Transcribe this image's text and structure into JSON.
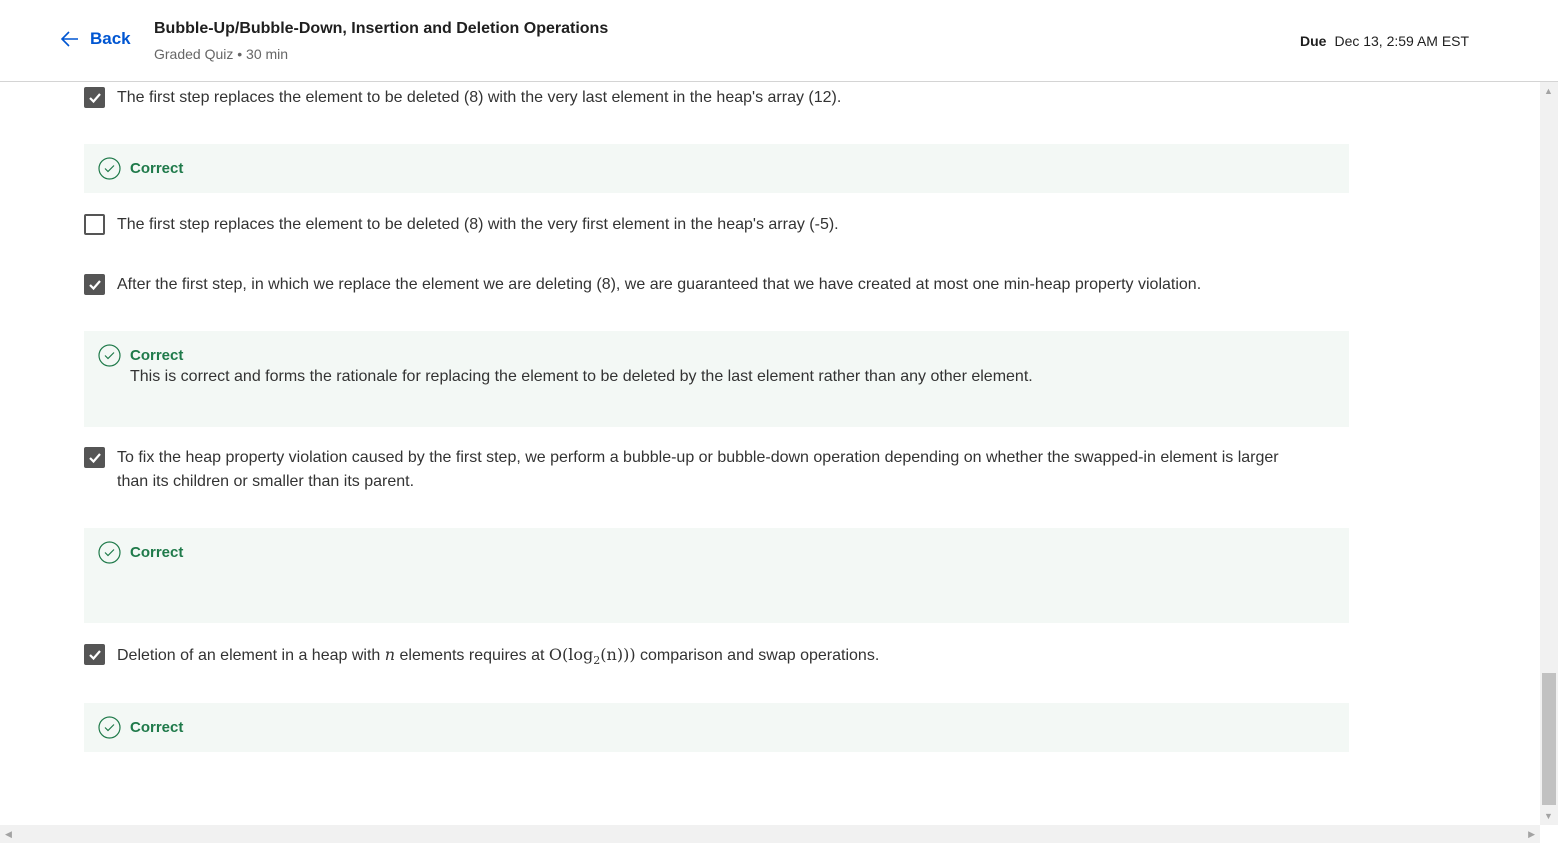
{
  "header": {
    "back_label": "Back",
    "title": "Bubble-Up/Bubble-Down, Insertion and Deletion Operations",
    "subtitle": "Graded Quiz • 30 min",
    "due_label": "Due",
    "due_value": "Dec 13, 2:59 AM EST"
  },
  "options": [
    {
      "text": "The first step replaces the element to be deleted (8) with the very last element in the heap's array (12).",
      "checked": true,
      "feedback": "Correct"
    },
    {
      "text": "The first step replaces the element to be deleted (8) with the very first element in the heap's array (-5).",
      "checked": false
    },
    {
      "text": "After the first step, in which we replace the element we are deleting (8), we are guaranteed that we have created at most one min-heap property violation.",
      "checked": true,
      "feedback": "Correct",
      "explanation": "This is correct and forms the rationale for replacing the element to be deleted by the last element rather than any other element."
    },
    {
      "text": "To fix the heap property violation caused by the first step, we perform a bubble-up or bubble-down operation depending on whether the swapped-in element is larger than its children or smaller than its parent.",
      "checked": true,
      "feedback": "Correct"
    },
    {
      "text_before": "Deletion of an element in a heap with",
      "var": "n",
      "text_mid": "elements requires at",
      "math": "O(log",
      "sub": "2",
      "math_end": "(n)))",
      "text_after": "comparison and swap operations.",
      "checked": true,
      "feedback": "Correct"
    }
  ]
}
